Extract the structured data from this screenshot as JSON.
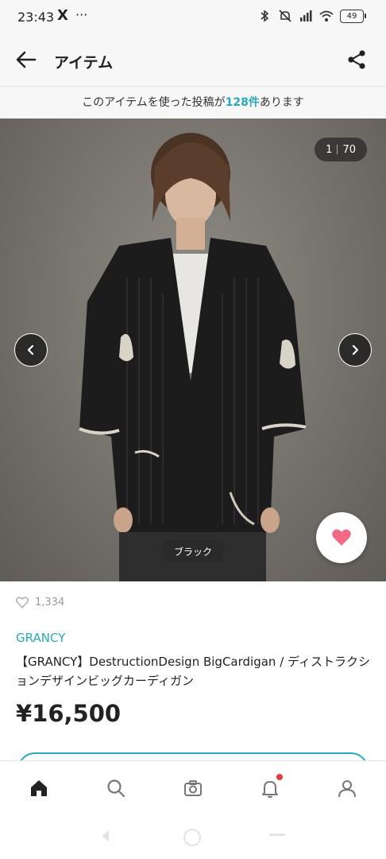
{
  "status_bar": {
    "time": "23:43",
    "x_icon": "X",
    "more": "···",
    "battery": "49"
  },
  "header": {
    "title": "アイテム"
  },
  "notice": {
    "prefix": "このアイテムを使った投稿が",
    "count": "128件",
    "suffix": "あります"
  },
  "image": {
    "index": "1",
    "total": "70",
    "color_label": "ブラック"
  },
  "product": {
    "likes": "1,334",
    "brand": "GRANCY",
    "name": "【GRANCY】DestructionDesign BigCardigan / ディストラクションデザインビッグカーディガン",
    "price": "¥16,500"
  },
  "colors": {
    "accent": "#2aa9b7",
    "like": "#f06a86",
    "badge": "#e23c3c"
  },
  "icons": {
    "back": "arrow-left-icon",
    "share": "share-icon",
    "prev": "chevron-left-icon",
    "next": "chevron-right-icon",
    "like": "heart-icon",
    "nav": [
      "home-icon",
      "search-icon",
      "camera-icon",
      "bell-icon",
      "user-icon"
    ]
  }
}
